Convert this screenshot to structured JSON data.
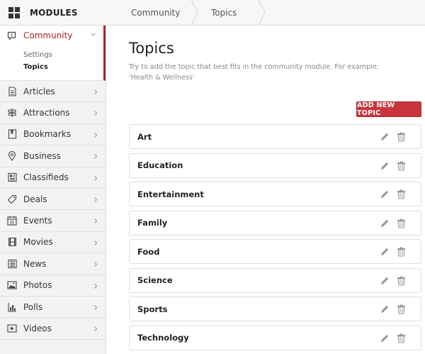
{
  "header": {
    "modules_label": "MODULES",
    "breadcrumbs": [
      {
        "label": "Community"
      },
      {
        "label": "Topics"
      }
    ]
  },
  "sidebar": {
    "active": {
      "label": "Community",
      "icon": "chat-bubble-icon",
      "subitems": [
        {
          "label": "Settings",
          "active": false
        },
        {
          "label": "Topics",
          "active": true
        }
      ]
    },
    "items": [
      {
        "label": "Articles",
        "icon": "article-icon"
      },
      {
        "label": "Attractions",
        "icon": "signpost-icon"
      },
      {
        "label": "Bookmarks",
        "icon": "bookmark-icon"
      },
      {
        "label": "Business",
        "icon": "map-pin-icon"
      },
      {
        "label": "Classifieds",
        "icon": "classifieds-icon"
      },
      {
        "label": "Deals",
        "icon": "tag-icon"
      },
      {
        "label": "Events",
        "icon": "calendar-icon"
      },
      {
        "label": "Movies",
        "icon": "film-icon"
      },
      {
        "label": "News",
        "icon": "news-icon"
      },
      {
        "label": "Photos",
        "icon": "photo-icon"
      },
      {
        "label": "Polls",
        "icon": "bar-chart-icon"
      },
      {
        "label": "Videos",
        "icon": "video-icon"
      }
    ]
  },
  "main": {
    "title": "Topics",
    "description": "Try to add the topic that best fits in the community module. For example: 'Health & Wellness'",
    "add_button": "ADD NEW TOPIC",
    "topics": [
      {
        "name": "Art"
      },
      {
        "name": "Education"
      },
      {
        "name": "Entertainment"
      },
      {
        "name": "Family"
      },
      {
        "name": "Food"
      },
      {
        "name": "Science"
      },
      {
        "name": "Sports"
      },
      {
        "name": "Technology"
      }
    ]
  },
  "colors": {
    "accent": "#b0212b",
    "button": "#c9353d"
  }
}
